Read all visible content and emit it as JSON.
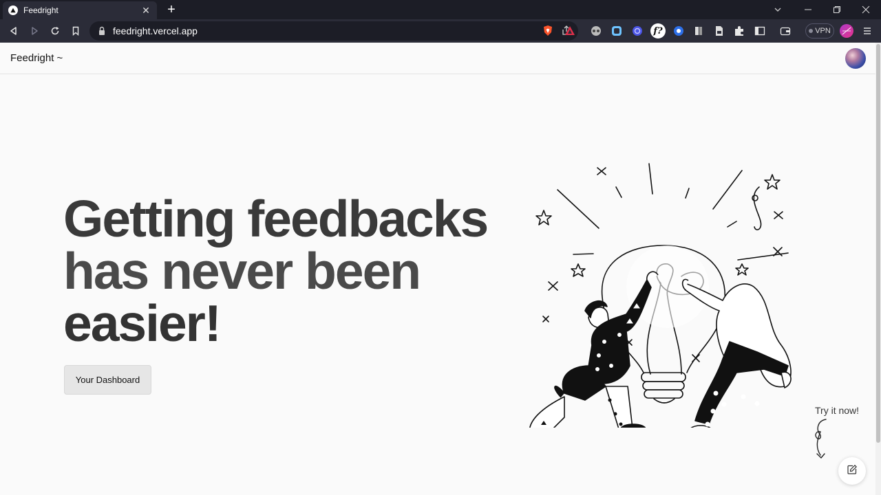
{
  "browser": {
    "tab_title": "Feedright",
    "url": "feedright.vercel.app",
    "vpn_label": "VPN"
  },
  "nav": {
    "brand": "Feedright ~"
  },
  "hero": {
    "line1": "Getting feedbacks",
    "line2": "has never been",
    "line3": "easier!",
    "button_label": "Your Dashboard"
  },
  "cta": {
    "try_label": "Try it now!"
  },
  "icons": {
    "feedback_fab": "edit-icon",
    "hero_image": "lightbulb-illustration"
  }
}
